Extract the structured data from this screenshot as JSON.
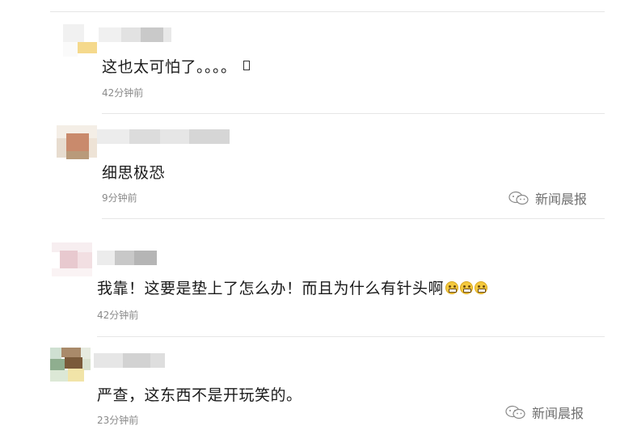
{
  "comments": [
    {
      "text": "这也太可怕了。。。。",
      "time": "42分钟前"
    },
    {
      "text": "细思极恐",
      "time": "9分钟前"
    },
    {
      "text": "我靠！这要是垫上了怎么办！而且为什么有针头啊",
      "time": "42分钟前"
    },
    {
      "text": "严查，这东西不是开玩笑的。",
      "time": "23分钟前"
    }
  ],
  "watermark": {
    "text": "新闻晨报",
    "icon": "wechat-icon"
  },
  "emoji": {
    "name": "grin-emoji",
    "count": 3
  },
  "colors": {
    "divider": "#e6e6e6",
    "text": "#1a1a1a",
    "time": "#8a8a8a",
    "emoji": "#f4c93e"
  }
}
